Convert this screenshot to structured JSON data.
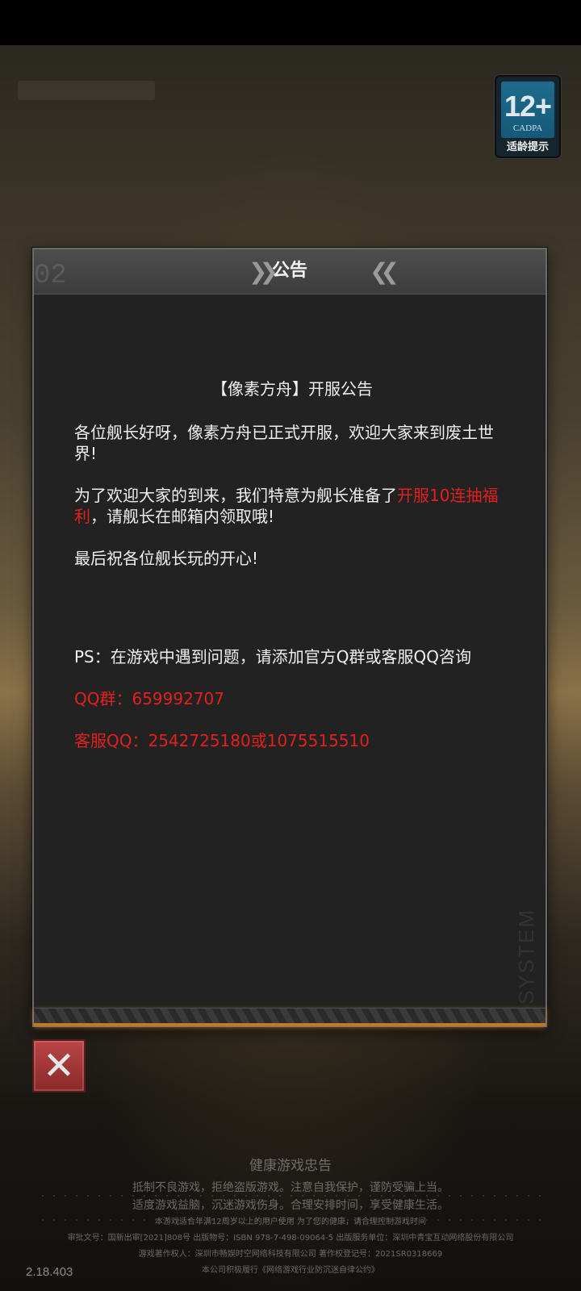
{
  "age_badge": {
    "rating": "12+",
    "org": "CADPA",
    "label": "适龄提示"
  },
  "notice_panel": {
    "title": "公告",
    "heading": "【像素方舟】开服公告",
    "para1": "各位舰长好呀，像素方舟已正式开服，欢迎大家来到废土世界!",
    "para2_prefix": "为了欢迎大家的到来，我们特意为舰长准备了",
    "para2_highlight": "开服10连抽福利",
    "para2_suffix": "，请舰长在邮箱内领取哦!",
    "para3": "最后祝各位舰长玩的开心!",
    "ps": "PS：在游戏中遇到问题，请添加官方Q群或客服QQ咨询",
    "qq_group": "QQ群：659992707",
    "service_qq": "客服QQ：2542725180或1075515510",
    "deco_text": "SYSTEM"
  },
  "close_button": {
    "icon": "close-icon",
    "glyph": "✕"
  },
  "footer": {
    "title": "健康游戏忠告",
    "line1": "抵制不良游戏，拒绝盗版游戏。注意自我保护，谨防受骗上当。",
    "line2": "适度游戏益脑，沉迷游戏伤身。合理安排时间，享受健康生活。",
    "small1": "本游戏适合年满12周岁以上的用户使用 为了您的健康，请合理控制游戏时间",
    "small2": "审批文号：国新出审[2021]808号 出版物号：ISBN 978-7-498-09064-5 出版服务单位：深圳中青宝互动网络股份有限公司",
    "small3": "游戏著作权人：深圳市畅娱时空网络科技有限公司 著作权登记号：2021SR0318669",
    "small4": "本公司积极履行《网络游戏行业防沉迷自律公约》"
  },
  "version": "2.18.403",
  "colors": {
    "highlight": "#e3201c",
    "accent_orange": "#c6791e"
  }
}
